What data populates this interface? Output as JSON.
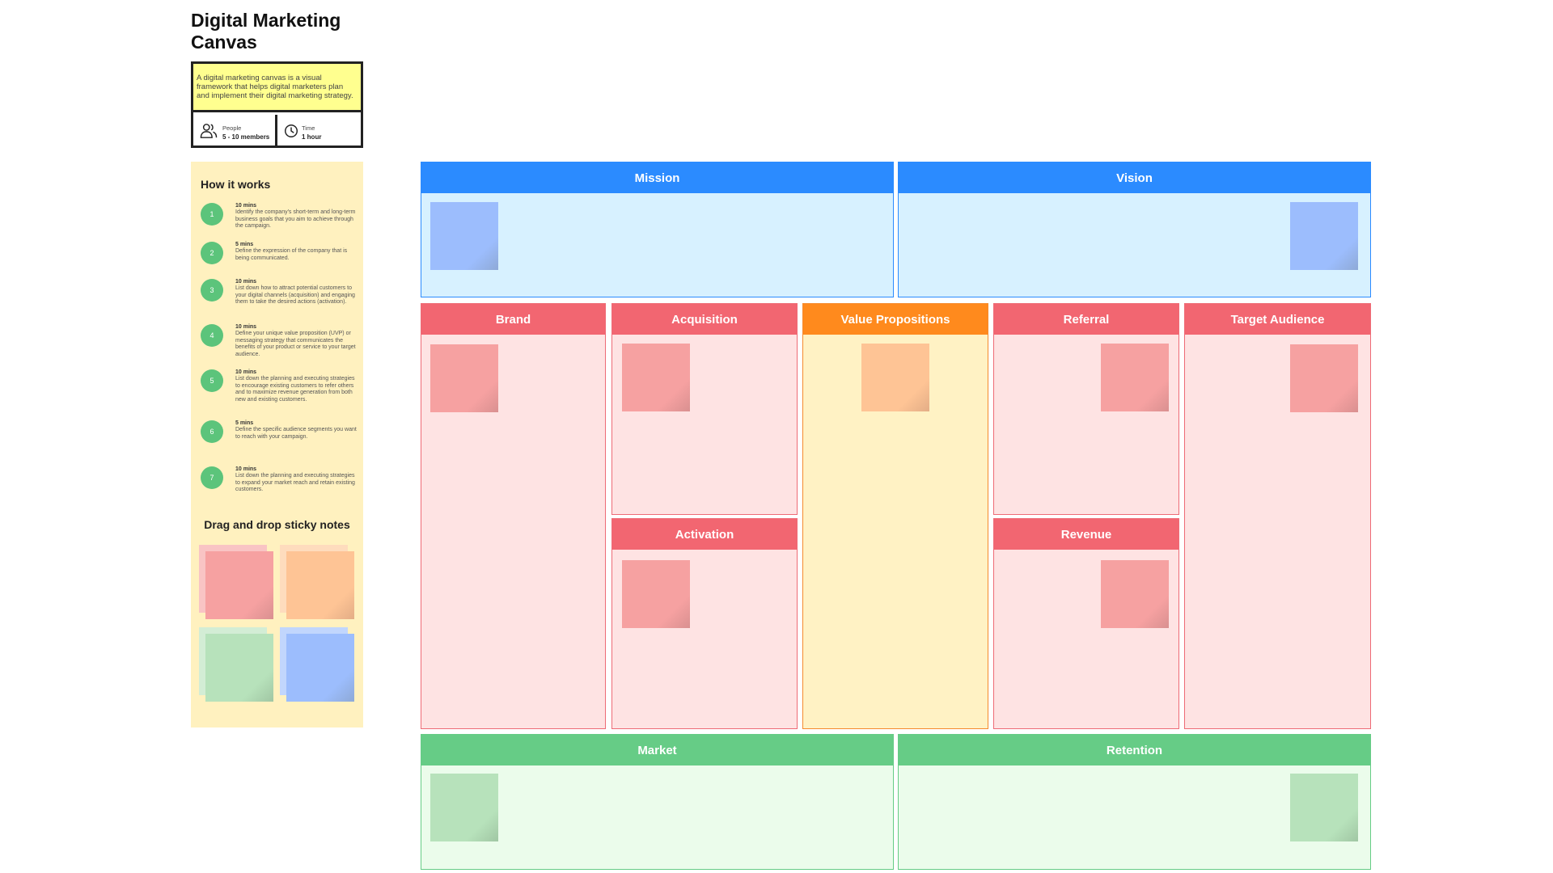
{
  "header": {
    "title": "Digital Marketing Canvas",
    "description": "A digital marketing canvas is a visual framework that helps digital marketers plan and implement their digital marketing strategy.",
    "people_label": "People",
    "people_value": "5 - 10 members",
    "time_label": "Time",
    "time_value": "1 hour",
    "icons": [
      "people-icon",
      "clock-icon"
    ]
  },
  "how_it_works": {
    "title": "How it works",
    "steps": [
      {
        "num": "1",
        "time": "10 mins",
        "text": "Identify the company's short-term and long-term business goals that you aim to achieve through the campaign."
      },
      {
        "num": "2",
        "time": "5 mins",
        "text": "Define the expression of the company that is being communicated."
      },
      {
        "num": "3",
        "time": "10 mins",
        "text": "List down how to attract potential customers to your digital channels (acquisition) and engaging them to take the desired actions (activation)."
      },
      {
        "num": "4",
        "time": "10 mins",
        "text": "Define your unique value proposition (UVP) or messaging strategy that communicates the benefits of your product or service to your target audience."
      },
      {
        "num": "5",
        "time": "10 mins",
        "text": "List down the planning and executing strategies to encourage existing customers to refer others and to maximize revenue generation from both new and existing customers."
      },
      {
        "num": "6",
        "time": "5 mins",
        "text": "Define the specific audience segments you want to reach with your campaign."
      },
      {
        "num": "7",
        "time": "10 mins",
        "text": "List down the planning and executing strategies to expand your market reach and retain existing customers."
      }
    ],
    "drag_title": "Drag and drop sticky notes",
    "sticky_colors": {
      "red": "#f6a1a1",
      "orange": "#fec495",
      "green": "#b7e2bb",
      "blue": "#9cbdfd"
    }
  },
  "sections": {
    "mission": "Mission",
    "vision": "Vision",
    "brand": "Brand",
    "acquisition": "Acquisition",
    "value_propositions": "Value Propositions",
    "referral": "Referral",
    "target_audience": "Target Audience",
    "activation": "Activation",
    "revenue": "Revenue",
    "market": "Market",
    "retention": "Retention"
  },
  "colors": {
    "blue_header": "#2b8bff",
    "red_header": "#f26671",
    "orange_header": "#ff8a1d",
    "green_header": "#66cc86",
    "step_circle": "#5cc47b",
    "panel_bg": "#fff1bf",
    "desc_bg": "#ffff8f"
  }
}
